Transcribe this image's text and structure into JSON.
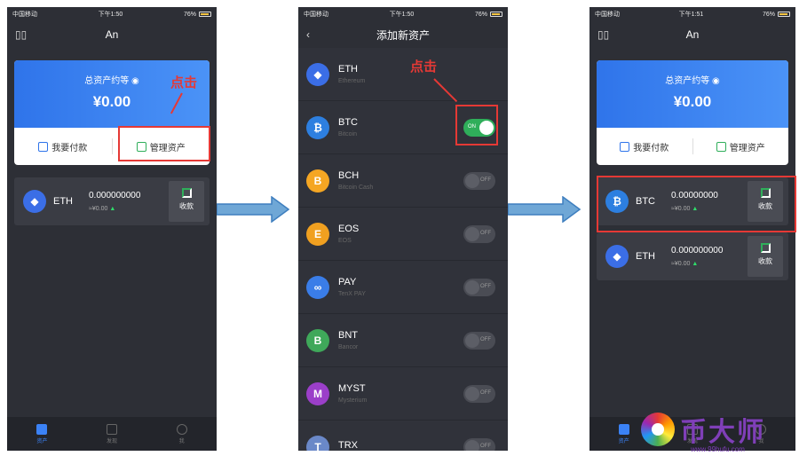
{
  "status": {
    "carrier": "中国移动",
    "battery": "76%",
    "time1": "下午1:50",
    "time3": "下午1:51"
  },
  "wallet": {
    "title": "An",
    "total_label": "总资产约等",
    "total_value": "¥0.00",
    "pay_label": "我要付款",
    "manage_label": "管理资产",
    "receive_label": "收款"
  },
  "assets": {
    "eth": {
      "symbol": "ETH",
      "amount": "0.000000000",
      "fiat": "≈¥0.00"
    },
    "btc": {
      "symbol": "BTC",
      "amount": "0.00000000",
      "fiat": "≈¥0.00"
    }
  },
  "tabs": [
    "资产",
    "发现",
    "我"
  ],
  "add_asset": {
    "title": "添加新资产",
    "items": [
      {
        "symbol": "ETH",
        "name": "Ethereum",
        "toggle": "",
        "color": "#3b6ee6",
        "glyph": "◆"
      },
      {
        "symbol": "BTC",
        "name": "Bitcoin",
        "toggle": "ON",
        "color": "#2d7fe0",
        "glyph": "₿"
      },
      {
        "symbol": "BCH",
        "name": "Bitcoin Cash",
        "toggle": "OFF",
        "color": "#f5a623",
        "glyph": "B"
      },
      {
        "symbol": "EOS",
        "name": "EOS",
        "toggle": "OFF",
        "color": "#f0a020",
        "glyph": "E"
      },
      {
        "symbol": "PAY",
        "name": "TenX PAY",
        "toggle": "OFF",
        "color": "#3a7de8",
        "glyph": "∞"
      },
      {
        "symbol": "BNT",
        "name": "Bancor",
        "toggle": "OFF",
        "color": "#3fa85a",
        "glyph": "B"
      },
      {
        "symbol": "MYST",
        "name": "Mysterium",
        "toggle": "OFF",
        "color": "#9b3fc9",
        "glyph": "M"
      },
      {
        "symbol": "TRX",
        "name": "",
        "toggle": "OFF",
        "color": "#6a88c8",
        "glyph": "T"
      }
    ]
  },
  "notes": {
    "click1": "点击",
    "click2": "点击"
  },
  "watermark": {
    "text": "币大师",
    "url": "www.99hufu.com"
  },
  "colors": {
    "accent": "#2f74ea",
    "highlight": "#e53935",
    "toggle_on": "#2fae5a"
  }
}
